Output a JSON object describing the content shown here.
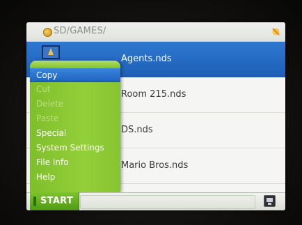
{
  "header": {
    "path": "SD/GAMES/",
    "folder_icon": "folder-icon",
    "stylus_icon": "stylus-icon"
  },
  "files": [
    {
      "name": "Agents.nds",
      "selected": true
    },
    {
      "name": "Room 215.nds",
      "selected": false
    },
    {
      "name": "DS.nds",
      "selected": false
    },
    {
      "name": "Mario Bros.nds",
      "selected": false
    }
  ],
  "menu": {
    "items": [
      {
        "label": "Copy",
        "state": "active"
      },
      {
        "label": "Cut",
        "state": "disabled"
      },
      {
        "label": "Delete",
        "state": "disabled"
      },
      {
        "label": "Paste",
        "state": "disabled"
      },
      {
        "label": "Special",
        "state": "enabled"
      },
      {
        "label": "System Settings",
        "state": "enabled"
      },
      {
        "label": "File Info",
        "state": "enabled"
      },
      {
        "label": "Help",
        "state": "enabled"
      }
    ]
  },
  "taskbar": {
    "start_label": "START",
    "tray_icon": "ds-console-icon"
  },
  "colors": {
    "selection_blue": "#1d5fb6",
    "menu_green": "#8ac737",
    "start_green": "#5fa71d"
  }
}
